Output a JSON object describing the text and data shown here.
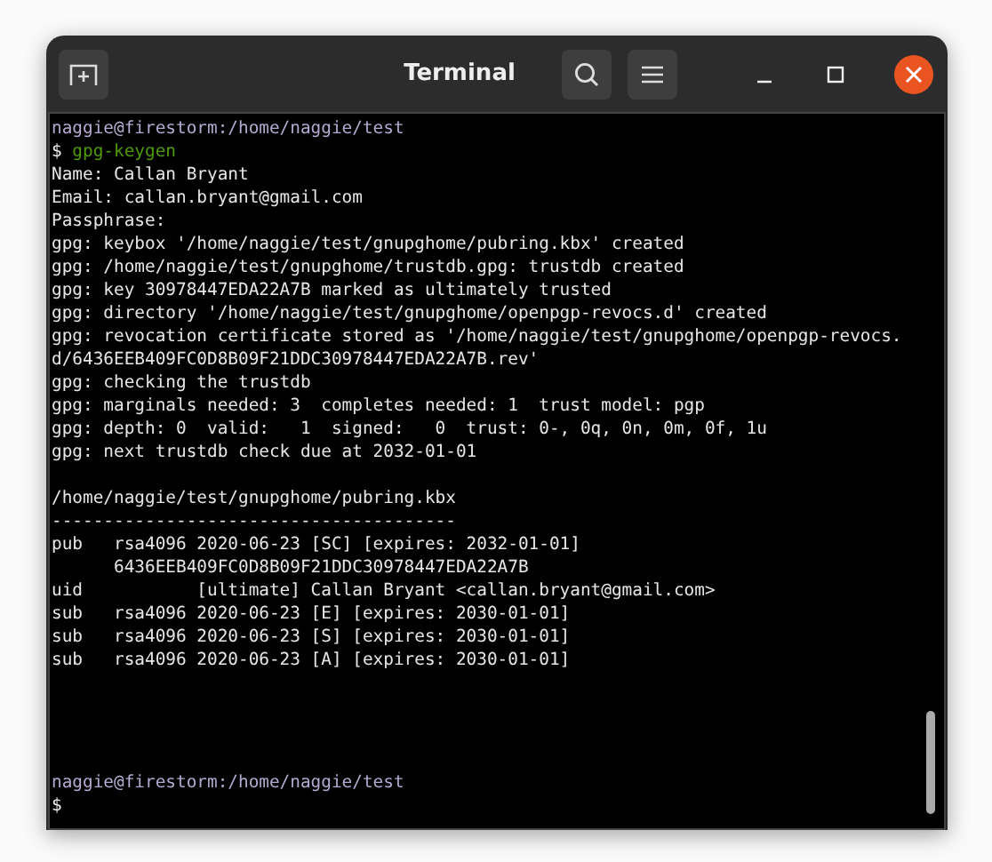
{
  "window": {
    "title": "Terminal"
  },
  "terminal": {
    "blocks": [
      {
        "lines": [
          {
            "kind": "prompt",
            "text": "naggie@firestorm:/home/naggie/test"
          },
          {
            "kind": "command",
            "symbol": "$",
            "text": "gpg-keygen"
          },
          {
            "kind": "output",
            "text": "Name: Callan Bryant"
          },
          {
            "kind": "output",
            "text": "Email: callan.bryant@gmail.com"
          },
          {
            "kind": "output",
            "text": "Passphrase:"
          },
          {
            "kind": "output",
            "text": "gpg: keybox '/home/naggie/test/gnupghome/pubring.kbx' created"
          },
          {
            "kind": "output",
            "text": "gpg: /home/naggie/test/gnupghome/trustdb.gpg: trustdb created"
          },
          {
            "kind": "output",
            "text": "gpg: key 30978447EDA22A7B marked as ultimately trusted"
          },
          {
            "kind": "output",
            "text": "gpg: directory '/home/naggie/test/gnupghome/openpgp-revocs.d' created"
          },
          {
            "kind": "output",
            "text": "gpg: revocation certificate stored as '/home/naggie/test/gnupghome/openpgp-revocs."
          },
          {
            "kind": "output",
            "text": "d/6436EEB409FC0D8B09F21DDC30978447EDA22A7B.rev'"
          },
          {
            "kind": "output",
            "text": "gpg: checking the trustdb"
          },
          {
            "kind": "output",
            "text": "gpg: marginals needed: 3  completes needed: 1  trust model: pgp"
          },
          {
            "kind": "output",
            "text": "gpg: depth: 0  valid:   1  signed:   0  trust: 0-, 0q, 0n, 0m, 0f, 1u"
          },
          {
            "kind": "output",
            "text": "gpg: next trustdb check due at 2032-01-01"
          }
        ]
      },
      {
        "lines": [
          {
            "kind": "output",
            "text": "/home/naggie/test/gnupghome/pubring.kbx"
          },
          {
            "kind": "output",
            "text": "---------------------------------------"
          },
          {
            "kind": "output",
            "text": "pub   rsa4096 2020-06-23 [SC] [expires: 2032-01-01]"
          },
          {
            "kind": "output",
            "text": "      6436EEB409FC0D8B09F21DDC30978447EDA22A7B"
          },
          {
            "kind": "output",
            "text": "uid           [ultimate] Callan Bryant <callan.bryant@gmail.com>"
          },
          {
            "kind": "output",
            "text": "sub   rsa4096 2020-06-23 [E] [expires: 2030-01-01]"
          },
          {
            "kind": "output",
            "text": "sub   rsa4096 2020-06-23 [S] [expires: 2030-01-01]"
          },
          {
            "kind": "output",
            "text": "sub   rsa4096 2020-06-23 [A] [expires: 2030-01-01]"
          }
        ]
      },
      {
        "lines": [
          {
            "kind": "prompt",
            "text": "naggie@firestorm:/home/naggie/test"
          },
          {
            "kind": "command",
            "symbol": "$"
          }
        ]
      }
    ]
  }
}
